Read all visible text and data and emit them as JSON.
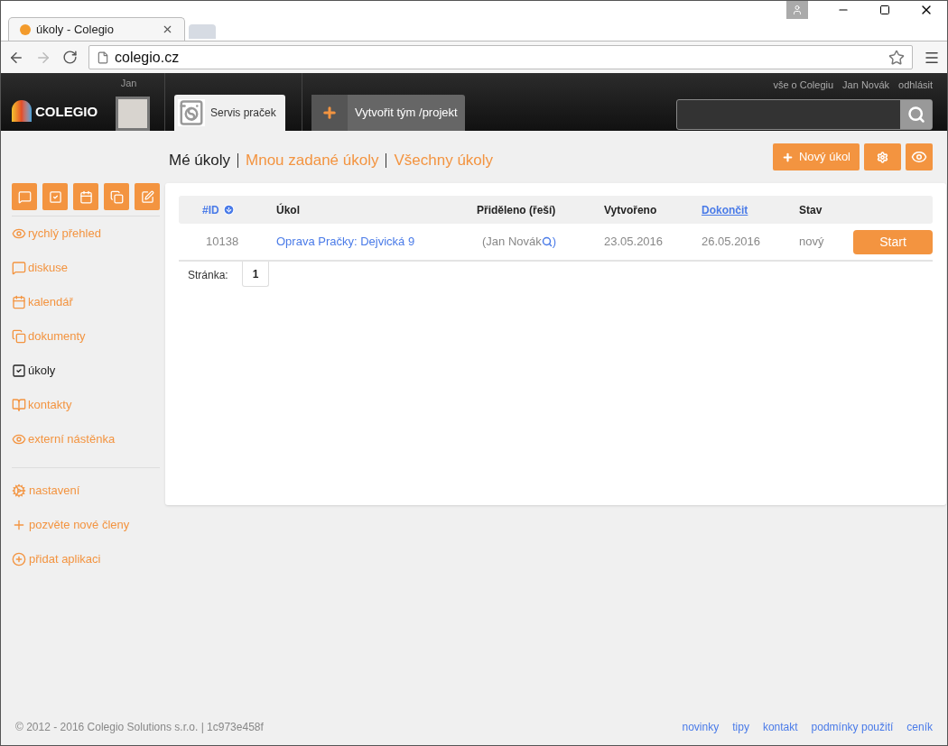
{
  "browser": {
    "tab_title": "úkoly - Colegio",
    "url": "colegio.cz"
  },
  "header": {
    "logo": "COLEGIO",
    "user_short": "Jan",
    "team_tab": "Servis praček",
    "create_team": "Vytvořit tým /projekt",
    "top_links": [
      "vše o Colegiu",
      "Jan Novák",
      "odhlásit"
    ]
  },
  "view_tabs": [
    {
      "label": "Mé úkoly",
      "selected": true
    },
    {
      "label": "Mnou zadané úkoly",
      "selected": false
    },
    {
      "label": "Všechny úkoly",
      "selected": false
    }
  ],
  "new_task_button": "Nový úkol",
  "sidebar": {
    "items": [
      {
        "kind": "eye",
        "label": "rychlý přehled",
        "selected": false
      },
      {
        "kind": "chat",
        "label": "diskuse",
        "selected": false
      },
      {
        "kind": "calendar",
        "label": "kalendář",
        "selected": false
      },
      {
        "kind": "docs",
        "label": "dokumenty",
        "selected": false
      },
      {
        "kind": "check",
        "label": "úkoly",
        "selected": true
      },
      {
        "kind": "book",
        "label": "kontakty",
        "selected": false
      },
      {
        "kind": "eye",
        "label": "externí nástěnka",
        "selected": false
      }
    ],
    "extra_items": [
      {
        "kind": "gears",
        "label": "nastavení"
      },
      {
        "kind": "plus",
        "label": "pozvěte nové členy"
      },
      {
        "kind": "plus-circle",
        "label": "přidat aplikaci"
      }
    ]
  },
  "table": {
    "columns": [
      "#ID",
      "Úkol",
      "Přiděleno (řeší)",
      "Vytvořeno",
      "Dokončit",
      "Stav"
    ],
    "rows": [
      {
        "id": "10138",
        "task": "Oprava Pračky: Dejvická 9",
        "assigned": "(Jan Novák",
        "assigned_end": ")",
        "created": "23.05.2016",
        "due": "26.05.2016",
        "status": "nový",
        "action": "Start"
      }
    ]
  },
  "pager": {
    "label": "Stránka:",
    "pages": [
      "1"
    ]
  },
  "footer": {
    "copyright": "© 2012 - 2016 Colegio Solutions s.r.o. | 1c973e458f",
    "links": [
      "novinky",
      "tipy",
      "kontakt",
      "podmínky použití",
      "ceník"
    ]
  }
}
